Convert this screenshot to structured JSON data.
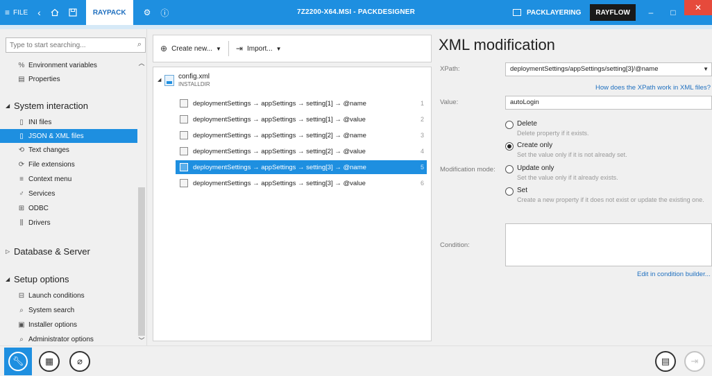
{
  "titlebar": {
    "menu_label": "FILE",
    "back_icon": "chevron-left-icon",
    "home_icon": "home-icon",
    "save_icon": "save-icon",
    "app_tab": "RAYPACK",
    "settings_icon": "gear-icon",
    "info_icon": "info-icon",
    "window_title": "7Z2200-X64.MSI - PACKDESIGNER",
    "packlayering_label": "PACKLAYERING",
    "rayflow_label": "RAYFLOW",
    "minimize": "–",
    "maximize": "□",
    "close": "✕",
    "accent_color": "#1e8fe0"
  },
  "sidebar": {
    "search_placeholder": "Type to start searching...",
    "items_top": [
      {
        "label": "Environment variables",
        "icon": "percent-icon"
      },
      {
        "label": "Properties",
        "icon": "properties-icon"
      }
    ],
    "section_system": "System interaction",
    "system_items": [
      {
        "label": "INI files",
        "icon": "ini-file-icon"
      },
      {
        "label": "JSON & XML files",
        "icon": "json-xml-file-icon",
        "selected": true
      },
      {
        "label": "Text changes",
        "icon": "text-changes-icon"
      },
      {
        "label": "File extensions",
        "icon": "file-extensions-icon"
      },
      {
        "label": "Context menu",
        "icon": "context-menu-icon"
      },
      {
        "label": "Services",
        "icon": "services-icon"
      },
      {
        "label": "ODBC",
        "icon": "odbc-icon"
      },
      {
        "label": "Drivers",
        "icon": "drivers-icon"
      }
    ],
    "section_database": "Database & Server",
    "section_setup": "Setup options",
    "setup_items": [
      {
        "label": "Launch conditions",
        "icon": "launch-conditions-icon"
      },
      {
        "label": "System search",
        "icon": "search-icon"
      },
      {
        "label": "Installer options",
        "icon": "installer-options-icon"
      },
      {
        "label": "Administrator options",
        "icon": "search-icon"
      }
    ]
  },
  "middle": {
    "create_new_label": "Create new...",
    "import_label": "Import...",
    "root_file": "config.xml",
    "root_dir": "INSTALLDIR",
    "rows": [
      {
        "text": "deploymentSettings → appSettings → setting[1] → @name",
        "num": "1"
      },
      {
        "text": "deploymentSettings → appSettings → setting[1] → @value",
        "num": "2"
      },
      {
        "text": "deploymentSettings → appSettings → setting[2] → @name",
        "num": "3"
      },
      {
        "text": "deploymentSettings → appSettings → setting[2] → @value",
        "num": "4"
      },
      {
        "text": "deploymentSettings → appSettings → setting[3] → @name",
        "num": "5",
        "selected": true
      },
      {
        "text": "deploymentSettings → appSettings → setting[3] → @value",
        "num": "6"
      }
    ]
  },
  "right": {
    "title": "XML modification",
    "xpath_label": "XPath:",
    "xpath_value": "deploymentSettings/appSettings/setting[3]/@name",
    "xpath_help_link": "How does the XPath work in XML files?",
    "value_label": "Value:",
    "value_value": "autoLogin",
    "mode_label": "Modification mode:",
    "modes": [
      {
        "title": "Delete",
        "desc": "Delete property if it exists.",
        "checked": false
      },
      {
        "title": "Create only",
        "desc": "Set the value only if it is not already set.",
        "checked": true
      },
      {
        "title": "Update only",
        "desc": "Set the value only if it already exists.",
        "checked": false
      },
      {
        "title": "Set",
        "desc": "Create a new property if it does not exist or update the existing one.",
        "checked": false
      }
    ],
    "condition_label": "Condition:",
    "condition_value": "",
    "condition_builder_link": "Edit in condition builder..."
  },
  "bottombar": {
    "left_buttons": [
      "wrench-icon",
      "grid-icon",
      "plug-icon"
    ],
    "right_buttons": [
      "document-icon",
      "exit-icon"
    ]
  }
}
